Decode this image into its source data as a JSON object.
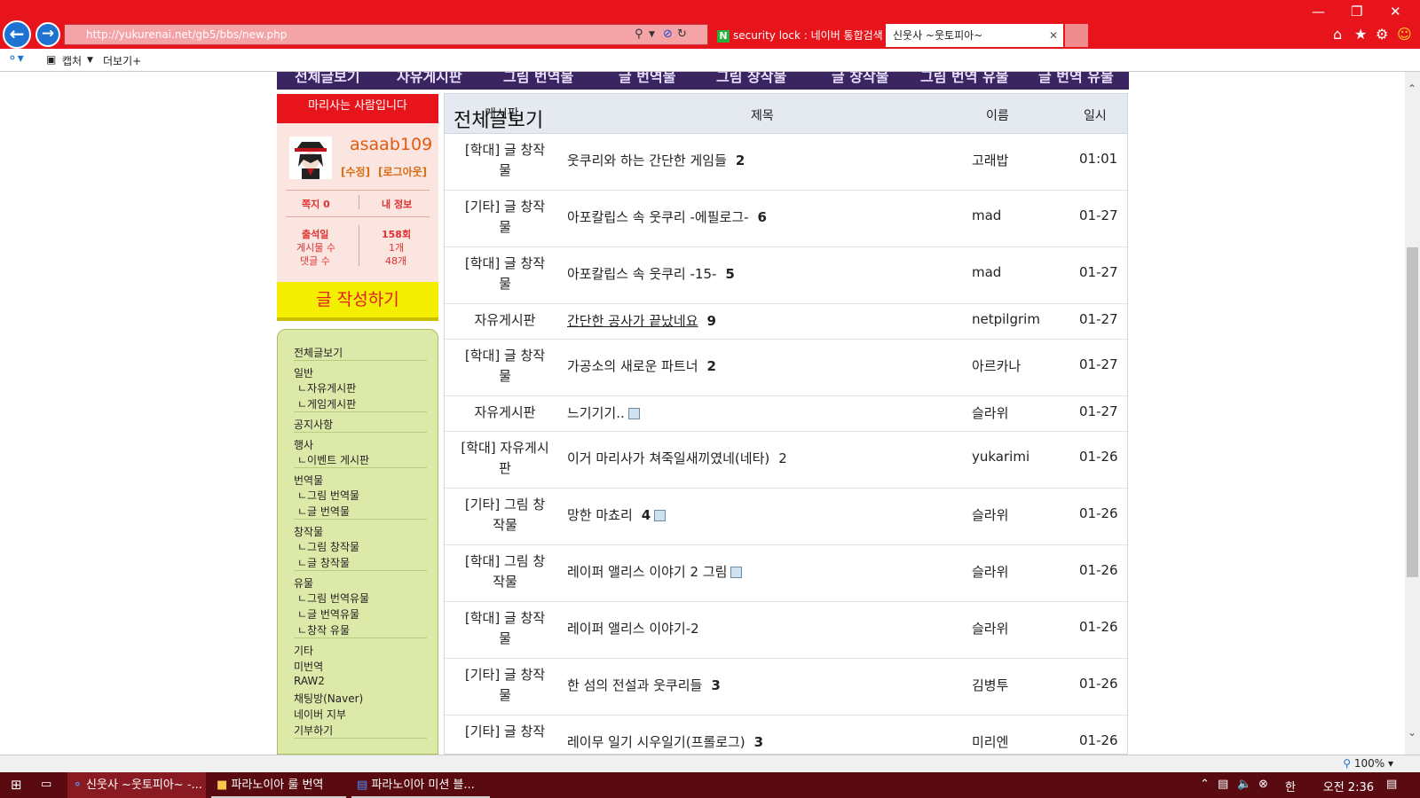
{
  "browser": {
    "url": "http://yukurenai.net/gb5/bbs/new.php",
    "tabs": [
      {
        "label": "security lock : 네이버 통합검색"
      },
      {
        "label": "신웃사 ~웃토피아~"
      }
    ],
    "command_bar": {
      "capture": "캡처",
      "more": "더보기+"
    },
    "zoom": "100%"
  },
  "top_menu": [
    "전체글보기",
    "자유게시판",
    "그림 번역물",
    "글 번역물",
    "그림 창작물",
    "글 창작물",
    "그림 번역 유물",
    "글 번역 유물"
  ],
  "profile": {
    "welcome": "마리사는 사람입니다",
    "username": "asaab109",
    "edit": "[수정]",
    "logout": "[로그아웃]",
    "memo": "쪽지 0",
    "my_info": "내 정보",
    "attendance_label": "출석일",
    "attendance_value": "158회",
    "posts_label": "게시물 수",
    "posts_value": "1개",
    "comments_label": "댓글 수",
    "comments_value": "48개"
  },
  "write_button": "글 작성하기",
  "side_menu": {
    "all": "전체글보기",
    "general": "일반",
    "free": "ㄴ자유게시판",
    "game": "ㄴ게임게시판",
    "notice": "공지사항",
    "event_group": "행사",
    "event": "ㄴ이벤트 게시판",
    "translation": "번역물",
    "pic_trans": "ㄴ그림 번역물",
    "text_trans": "ㄴ글 번역물",
    "creation": "창작물",
    "pic_create": "ㄴ그림 창작물",
    "text_create": "ㄴ글 창작물",
    "relic": "유물",
    "pic_relic": "ㄴ그림 번역유물",
    "text_relic": "ㄴ글 번역유물",
    "create_relic": "ㄴ창작 유물",
    "etc": "기타",
    "untranslated": "미번역",
    "raw2": "RAW2",
    "chat": "채팅방(Naver)",
    "naver_branch": "네이버 지부",
    "donate": "기부하기"
  },
  "board": {
    "title": "전체글보기",
    "col_board": "게시판",
    "col_subject": "제목",
    "col_author": "이름",
    "col_date": "일시",
    "rows": [
      {
        "cat1": "[학대] 글 창작",
        "cat2": "물",
        "subject": "웃쿠리와 하는 간단한 게임들",
        "count": "2",
        "author": "고래밥",
        "date": "01:01"
      },
      {
        "cat1": "[기타] 글 창작",
        "cat2": "물",
        "subject": "아포칼립스 속 웃쿠리 -에필로그-",
        "count": "6",
        "author": "mad",
        "date": "01-27"
      },
      {
        "cat1": "[학대] 글 창작",
        "cat2": "물",
        "subject": "아포칼립스 속 웃쿠리 -15-",
        "count": "5",
        "author": "mad",
        "date": "01-27"
      },
      {
        "cat1": "자유게시판",
        "cat2": "",
        "subject": "간단한 공사가 끝났네요",
        "count": "9",
        "author": "netpilgrim",
        "date": "01-27"
      },
      {
        "cat1": "[학대] 글 창작",
        "cat2": "물",
        "subject": "가공소의 새로운 파트너",
        "count": "2",
        "author": "아르카나",
        "date": "01-27"
      },
      {
        "cat1": "자유게시판",
        "cat2": "",
        "subject": "느기기기..",
        "count": "",
        "author": "슬라위",
        "date": "01-27"
      },
      {
        "cat1": "[학대] 자유게시",
        "cat2": "판",
        "subject": "이거 마리사가 쳐죽일새끼였네(네타)",
        "count": "2",
        "author": "yukarimi",
        "date": "01-26"
      },
      {
        "cat1": "[기타] 그림 창",
        "cat2": "작물",
        "subject": "망한 마쵸리",
        "count": "4",
        "author": "슬라위",
        "date": "01-26"
      },
      {
        "cat1": "[학대] 그림 창",
        "cat2": "작물",
        "subject": "레이퍼 앨리스 이야기 2 그림",
        "count": "",
        "author": "슬라위",
        "date": "01-26"
      },
      {
        "cat1": "[학대] 글 창작",
        "cat2": "물",
        "subject": "레이퍼 앨리스 이야기-2",
        "count": "",
        "author": "슬라위",
        "date": "01-26"
      },
      {
        "cat1": "[기타] 글 창작",
        "cat2": "물",
        "subject": "한 섬의 전설과 웃쿠리들",
        "count": "3",
        "author": "김병투",
        "date": "01-26"
      },
      {
        "cat1": "[기타] 글 창작",
        "cat2": "",
        "subject": "레이무 일기 시우일기(프롤로그)",
        "count": "3",
        "author": "미리엔",
        "date": "01-26"
      }
    ]
  },
  "taskbar": {
    "items": [
      "신웃사 ~웃토피아~ -...",
      "파라노이아 룰 번역",
      "파라노이아 미션 블..."
    ],
    "clock": "오전 2:36",
    "ime": "한"
  },
  "colors": {
    "chrome": "#e8141c",
    "sidebar_green": "#dce9a8",
    "write_yellow": "#f4ef00",
    "header_bg": "#e4eaf0"
  }
}
